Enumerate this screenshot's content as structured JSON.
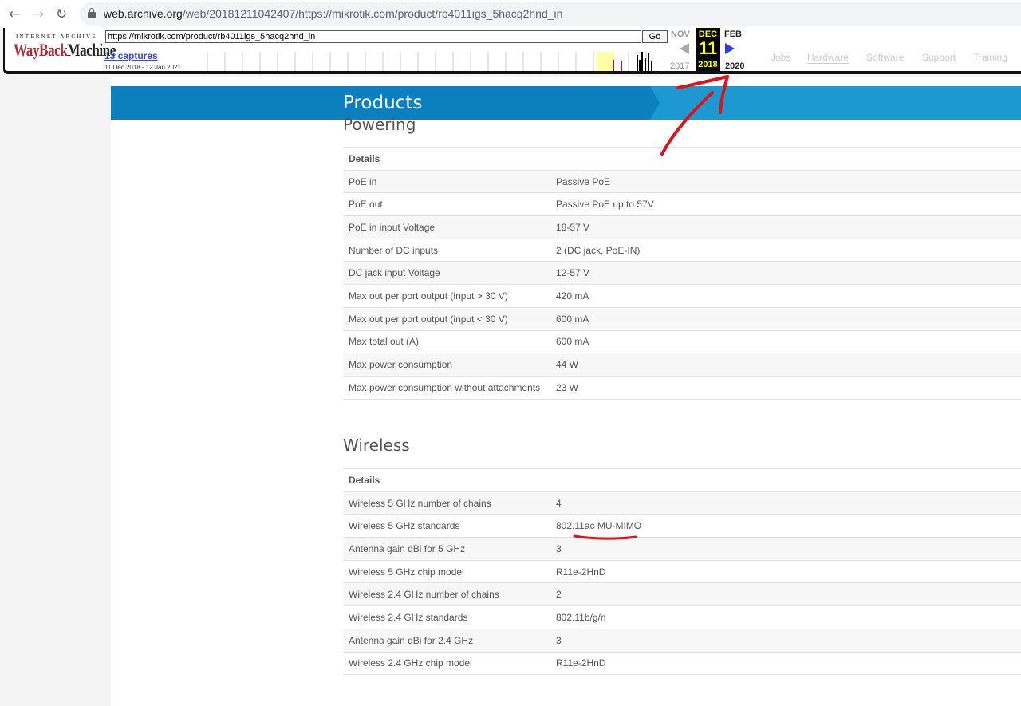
{
  "browser": {
    "url_host": "web.archive.org",
    "url_path": "/web/20181211042407/https://mikrotik.com/product/rb4011igs_5hacq2hnd_in"
  },
  "wayback": {
    "brand_top": "INTERNET ARCHIVE",
    "brand_logo_a": "WayBack",
    "brand_logo_b": "Machine",
    "url_value": "https://mikrotik.com/product/rb4011igs_5hacq2hnd_in",
    "go_label": "Go",
    "captures_label": "13 captures",
    "range_label": "11 Dec 2018 - 12 Jan 2021",
    "prev_month": "NOV",
    "current_month": "DEC",
    "next_month": "FEB",
    "current_day": "11",
    "prev_year": "2017",
    "current_year": "2018",
    "next_year": "2020",
    "ghost_nav": [
      "Jobs",
      "Hardware",
      "Software",
      "Support",
      "Training"
    ]
  },
  "page": {
    "banner_title": "Products",
    "powering": {
      "title": "Powering",
      "header": "Details",
      "rows": [
        [
          "PoE in",
          "Passive PoE"
        ],
        [
          "PoE out",
          "Passive PoE up to 57V"
        ],
        [
          "PoE in input Voltage",
          "18-57 V"
        ],
        [
          "Number of DC inputs",
          "2 (DC jack, PoE-IN)"
        ],
        [
          "DC jack input Voltage",
          "12-57 V"
        ],
        [
          "Max out per port output (input > 30 V)",
          "420 mA"
        ],
        [
          "Max out per port output (input < 30 V)",
          "600 mA"
        ],
        [
          "Max total out (A)",
          "600 mA"
        ],
        [
          "Max power consumption",
          "44 W"
        ],
        [
          "Max power consumption without attachments",
          "23 W"
        ]
      ]
    },
    "wireless": {
      "title": "Wireless",
      "header": "Details",
      "rows": [
        [
          "Wireless 5 GHz number of chains",
          "4"
        ],
        [
          "Wireless 5 GHz standards",
          "802.11ac MU-MIMO"
        ],
        [
          "Antenna gain dBi for 5 GHz",
          "3"
        ],
        [
          "Wireless 5 GHz chip model",
          "R11e-2HnD"
        ],
        [
          "Wireless 2.4 GHz number of chains",
          "2"
        ],
        [
          "Wireless 2.4 GHz standards",
          "802.11b/g/n"
        ],
        [
          "Antenna gain dBi for 2.4 GHz",
          "3"
        ],
        [
          "Wireless 2.4 GHz chip model",
          "R11e-2HnD"
        ]
      ]
    }
  },
  "colors": {
    "banner_dark": "#0c7fbe",
    "banner_light": "#1e98d1",
    "annotation_red": "#d9141b",
    "wayback_yellow": "#ffff00"
  }
}
